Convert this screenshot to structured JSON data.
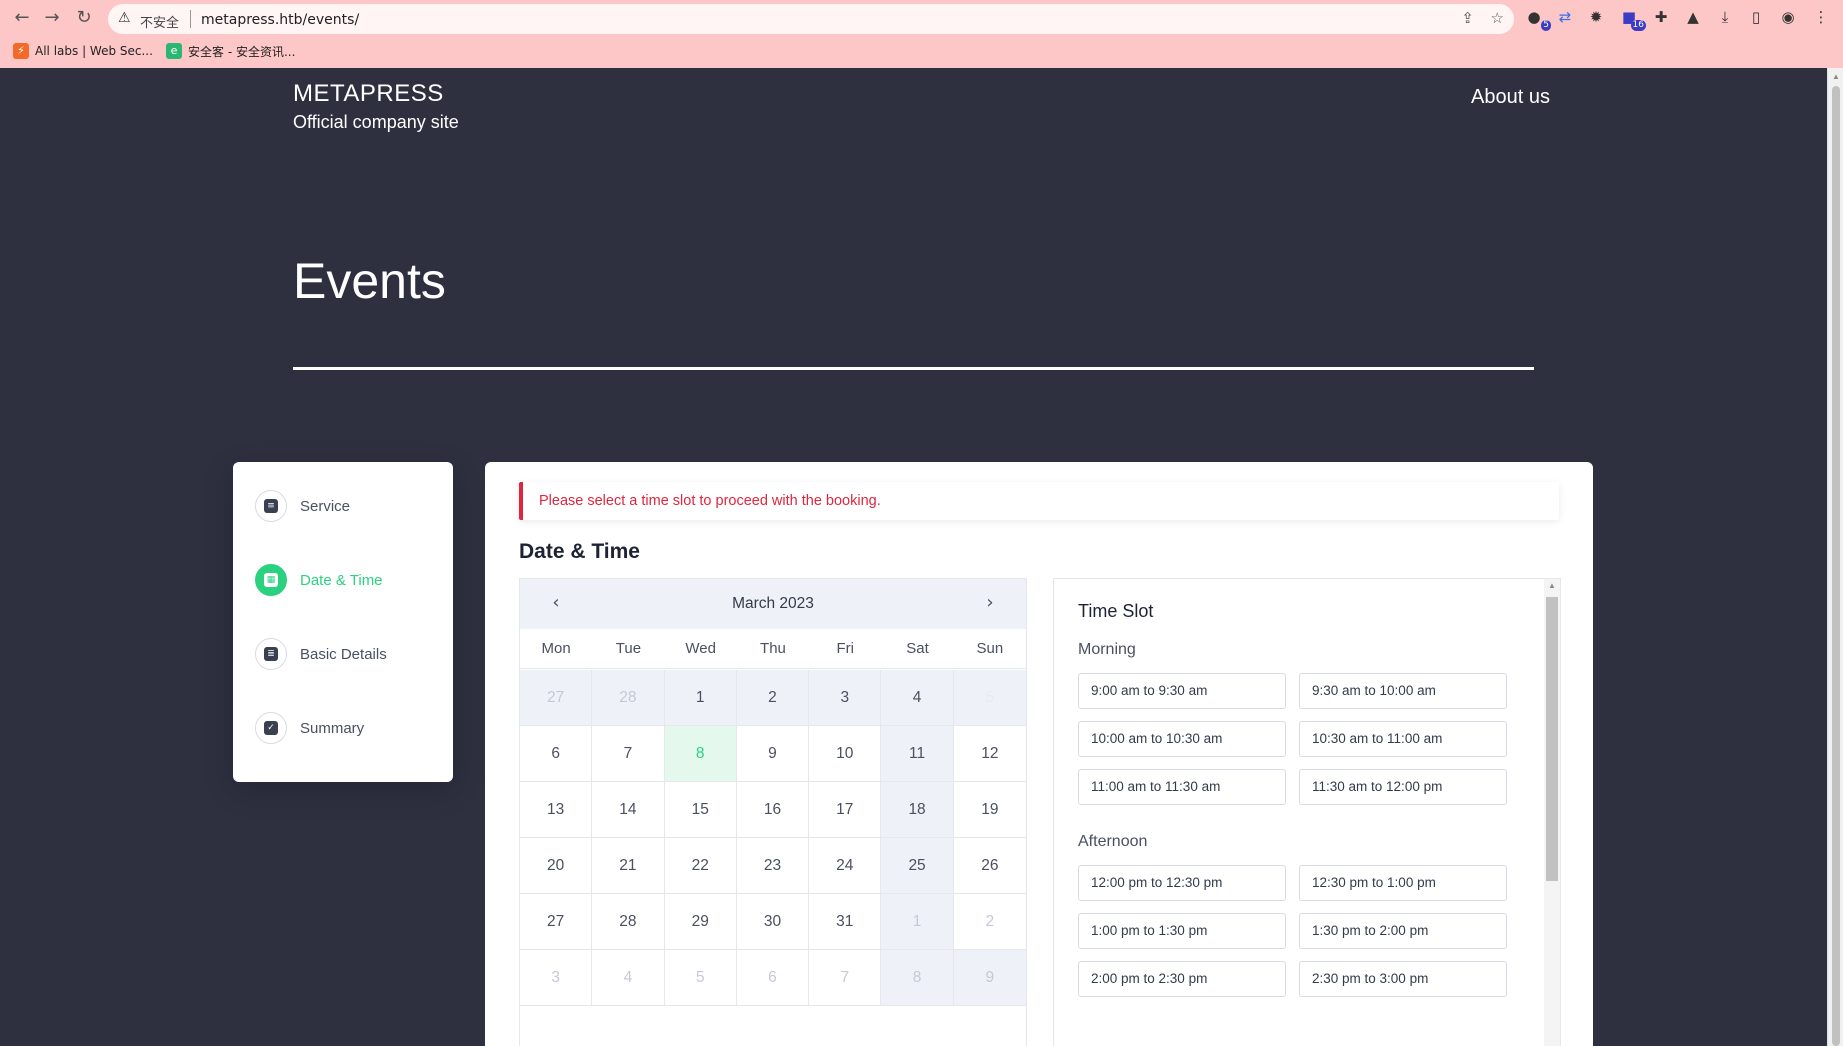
{
  "browser": {
    "insecure_label": "不安全",
    "url": "metapress.htb/events/",
    "extensions": [
      {
        "name": "ext-1",
        "badge": "5"
      },
      {
        "name": "ext-2",
        "badge": ""
      },
      {
        "name": "ext-3",
        "badge": ""
      },
      {
        "name": "ext-4",
        "badge": "16"
      }
    ],
    "bookmarks": [
      {
        "label": "All labs | Web Sec..."
      },
      {
        "label": "安全客 - 安全资讯..."
      }
    ]
  },
  "site": {
    "name": "METAPRESS",
    "tagline": "Official company site",
    "nav_about": "About us",
    "page_title": "Events"
  },
  "steps": [
    {
      "label": "Service",
      "icon": "server-icon",
      "active": false
    },
    {
      "label": "Date & Time",
      "icon": "calendar-icon",
      "active": true
    },
    {
      "label": "Basic Details",
      "icon": "document-icon",
      "active": false
    },
    {
      "label": "Summary",
      "icon": "checklist-icon",
      "active": false
    }
  ],
  "booking": {
    "alert": "Please select a time slot to proceed with the booking.",
    "section_title": "Date & Time"
  },
  "calendar": {
    "month_label": "March 2023",
    "days_of_week": [
      "Mon",
      "Tue",
      "Wed",
      "Thu",
      "Fri",
      "Sat",
      "Sun"
    ],
    "selected": "8",
    "rows": [
      [
        "27",
        "28",
        "1",
        "2",
        "3",
        "4",
        "5"
      ],
      [
        "6",
        "7",
        "8",
        "9",
        "10",
        "11",
        "12"
      ],
      [
        "13",
        "14",
        "15",
        "16",
        "17",
        "18",
        "19"
      ],
      [
        "20",
        "21",
        "22",
        "23",
        "24",
        "25",
        "26"
      ],
      [
        "27",
        "28",
        "29",
        "30",
        "31",
        "1",
        "2"
      ],
      [
        "3",
        "4",
        "5",
        "6",
        "7",
        "8",
        "9"
      ]
    ]
  },
  "time_slots": {
    "title": "Time Slot",
    "morning_label": "Morning",
    "morning": [
      "9:00 am to 9:30 am",
      "9:30 am to 10:00 am",
      "10:00 am to 10:30 am",
      "10:30 am to 11:00 am",
      "11:00 am to 11:30 am",
      "11:30 am to 12:00 pm"
    ],
    "afternoon_label": "Afternoon",
    "afternoon": [
      "12:00 pm to 12:30 pm",
      "12:30 pm to 1:00 pm",
      "1:00 pm to 1:30 pm",
      "1:30 pm to 2:00 pm",
      "2:00 pm to 2:30 pm",
      "2:30 pm to 3:00 pm"
    ]
  }
}
